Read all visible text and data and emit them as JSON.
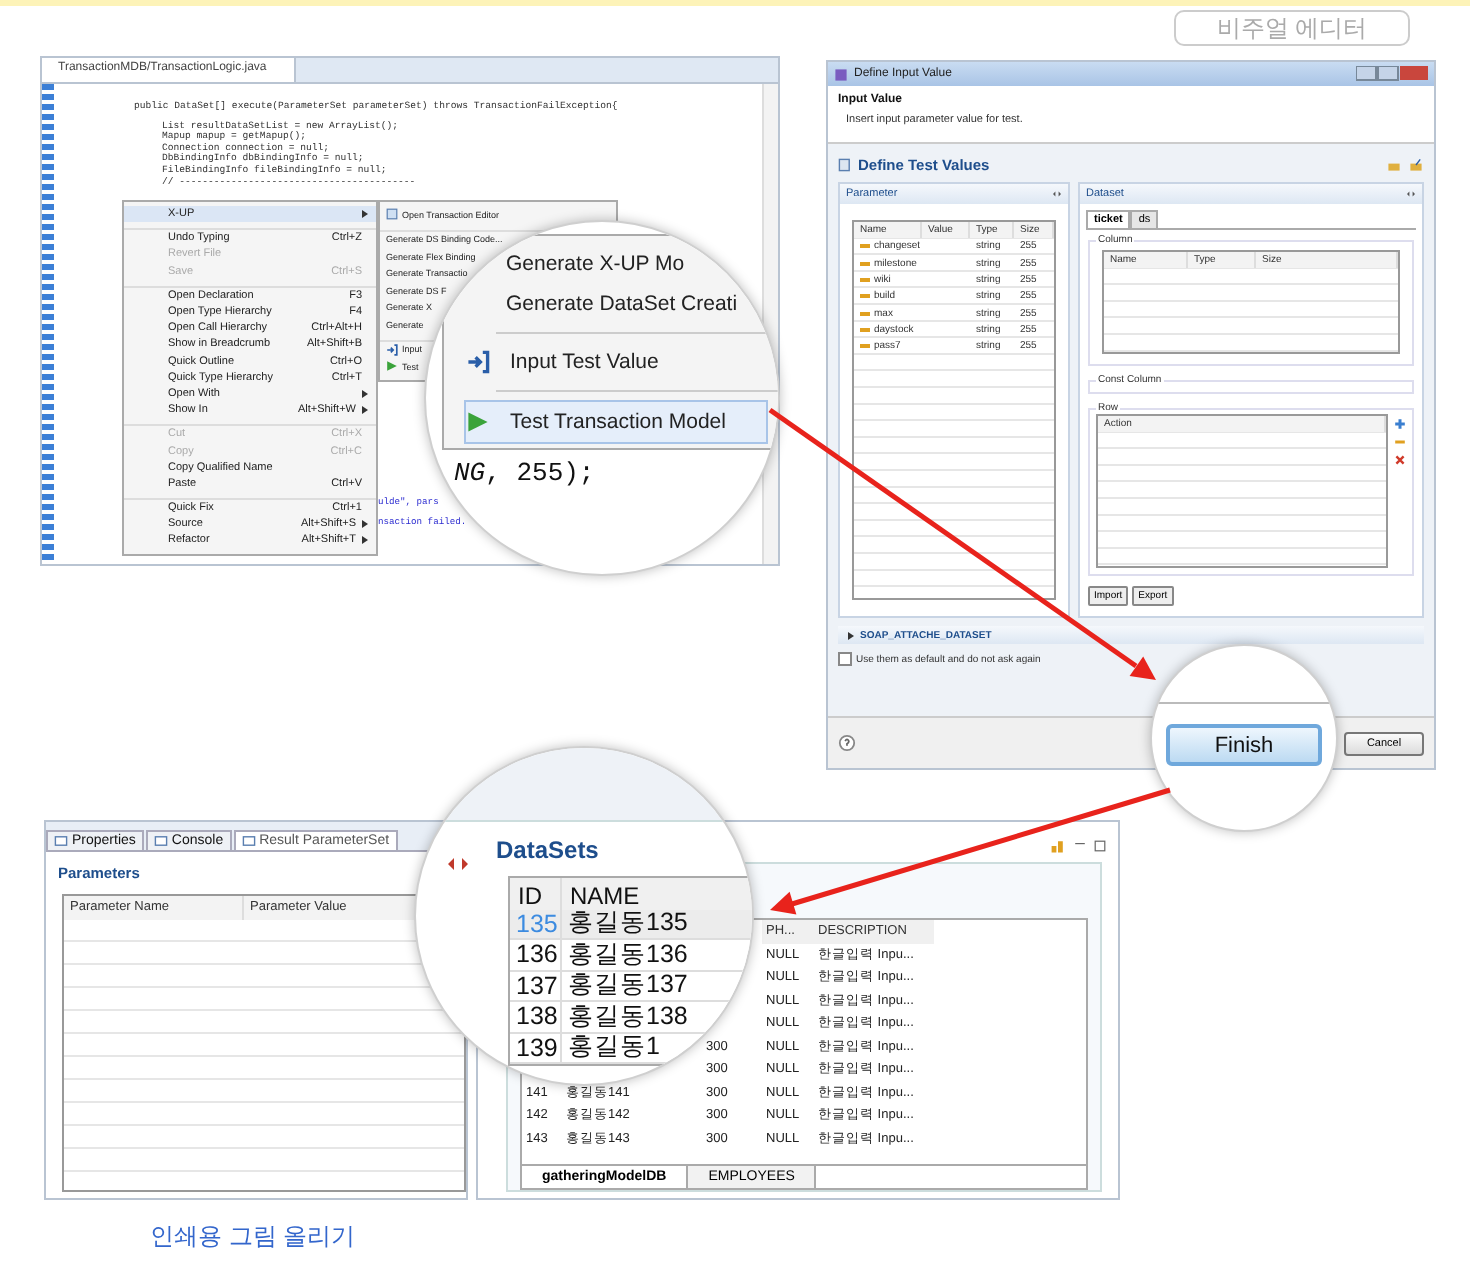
{
  "top_bar": {
    "button": "비주얼 에디터"
  },
  "editor": {
    "tab": "TransactionMDB/TransactionLogic.java",
    "code_lines": [
      "public DataSet[] execute(ParameterSet parameterSet) throws TransactionFailException{",
      "List resultDataSetList = new ArrayList();",
      "Mapup mapup = getMapup();",
      "Connection connection = null;",
      "DbBindingInfo dbBindingInfo = null;",
      "FileBindingInfo fileBindingInfo = null;",
      "// -----------------------------------------"
    ],
    "code_fragments": [
      "ulde\", pars",
      "nsaction failed."
    ],
    "context_menu": [
      {
        "label": "X-UP",
        "submenu": true,
        "disabled": false,
        "separator_before": false,
        "selected": true
      },
      {
        "label": "Undo Typing",
        "shortcut": "Ctrl+Z",
        "submenu": false,
        "disabled": false,
        "separator_before": true,
        "selected": false
      },
      {
        "label": "Revert File",
        "submenu": false,
        "disabled": true,
        "separator_before": false,
        "selected": false
      },
      {
        "label": "Save",
        "shortcut": "Ctrl+S",
        "submenu": false,
        "disabled": true,
        "separator_before": false,
        "selected": false
      },
      {
        "label": "Open Declaration",
        "shortcut": "F3",
        "submenu": false,
        "disabled": false,
        "separator_before": true,
        "selected": false
      },
      {
        "label": "Open Type Hierarchy",
        "shortcut": "F4",
        "submenu": false,
        "disabled": false,
        "separator_before": false,
        "selected": false
      },
      {
        "label": "Open Call Hierarchy",
        "shortcut": "Ctrl+Alt+H",
        "submenu": false,
        "disabled": false,
        "separator_before": false,
        "selected": false
      },
      {
        "label": "Show in Breadcrumb",
        "shortcut": "Alt+Shift+B",
        "submenu": false,
        "disabled": false,
        "separator_before": false,
        "selected": false
      },
      {
        "label": "Quick Outline",
        "shortcut": "Ctrl+O",
        "submenu": false,
        "disabled": false,
        "separator_before": false,
        "selected": false
      },
      {
        "label": "Quick Type Hierarchy",
        "shortcut": "Ctrl+T",
        "submenu": false,
        "disabled": false,
        "separator_before": false,
        "selected": false
      },
      {
        "label": "Open With",
        "submenu": true,
        "disabled": false,
        "separator_before": false,
        "selected": false
      },
      {
        "label": "Show In",
        "shortcut": "Alt+Shift+W",
        "submenu": true,
        "disabled": false,
        "separator_before": false,
        "selected": false
      },
      {
        "label": "Cut",
        "shortcut": "Ctrl+X",
        "submenu": false,
        "disabled": true,
        "separator_before": true,
        "selected": false
      },
      {
        "label": "Copy",
        "shortcut": "Ctrl+C",
        "submenu": false,
        "disabled": true,
        "separator_before": false,
        "selected": false
      },
      {
        "label": "Copy Qualified Name",
        "submenu": false,
        "disabled": false,
        "separator_before": false,
        "selected": false
      },
      {
        "label": "Paste",
        "shortcut": "Ctrl+V",
        "submenu": false,
        "disabled": false,
        "separator_before": false,
        "selected": false
      },
      {
        "label": "Quick Fix",
        "shortcut": "Ctrl+1",
        "submenu": false,
        "disabled": false,
        "separator_before": true,
        "selected": false
      },
      {
        "label": "Source",
        "shortcut": "Alt+Shift+S",
        "submenu": true,
        "disabled": false,
        "separator_before": false,
        "selected": false
      },
      {
        "label": "Refactor",
        "shortcut": "Alt+Shift+T",
        "submenu": true,
        "disabled": false,
        "separator_before": false,
        "selected": false
      }
    ],
    "submenu": [
      {
        "label": "Open Transaction Editor",
        "kind": "editor",
        "separator_before": false
      },
      {
        "label": "Generate DS Binding Code...",
        "kind": "plain",
        "separator_before": true
      },
      {
        "label": "Generate Flex Binding",
        "kind": "plain",
        "separator_before": false
      },
      {
        "label": "Generate Transactio",
        "kind": "plain",
        "separator_before": false
      },
      {
        "label": "Generate DS F",
        "kind": "plain",
        "separator_before": false
      },
      {
        "label": "Generate X",
        "kind": "plain",
        "separator_before": false
      },
      {
        "label": "Generate",
        "kind": "plain",
        "separator_before": false
      },
      {
        "label": "Input",
        "kind": "input",
        "separator_before": true
      },
      {
        "label": "Test",
        "kind": "run",
        "separator_before": false
      }
    ],
    "magnifier": {
      "items": [
        {
          "label": "Generate X-UP Mo",
          "kind": "plain",
          "separator_before": false,
          "selected": false
        },
        {
          "label": "Generate DataSet Creati",
          "kind": "plain",
          "separator_before": false,
          "selected": false
        },
        {
          "label": "Input Test Value",
          "kind": "input",
          "separator_before": true,
          "selected": false
        },
        {
          "label": "Test Transaction Model",
          "kind": "run",
          "separator_before": true,
          "selected": true
        }
      ],
      "code": "*NG*, 255);"
    }
  },
  "dialog": {
    "title": "Define Input Value",
    "header_title": "Input Value",
    "header_text": "Insert input parameter value for test.",
    "section_title": "Define Test Values",
    "parameter": {
      "title": "Parameter",
      "columns": [
        "Name",
        "Value",
        "Type",
        "Size"
      ],
      "rows": [
        {
          "name": "changeset",
          "type": "string",
          "size": "255"
        },
        {
          "name": "milestone",
          "type": "string",
          "size": "255"
        },
        {
          "name": "wiki",
          "type": "string",
          "size": "255"
        },
        {
          "name": "build",
          "type": "string",
          "size": "255"
        },
        {
          "name": "max",
          "type": "string",
          "size": "255"
        },
        {
          "name": "daystock",
          "type": "string",
          "size": "255"
        },
        {
          "name": "pass7",
          "type": "string",
          "size": "255"
        }
      ]
    },
    "dataset": {
      "title": "Dataset",
      "tabs": [
        {
          "label": "ticket",
          "selected": true
        },
        {
          "label": "ds",
          "selected": false
        }
      ],
      "column_group": "Column",
      "column_headers": [
        "Name",
        "Type",
        "Size"
      ],
      "const_group": "Const Column",
      "row_group": "Row",
      "row_headers": [
        "Action"
      ],
      "buttons": [
        "Import",
        "Export"
      ]
    },
    "soap": "SOAP_ATTACHE_DATASET",
    "checkbox": {
      "label": "Use them as default and do not ask again",
      "checked": false
    },
    "finish": "Finish",
    "cancel": "Cancel"
  },
  "result_panel": {
    "tabs": [
      {
        "label": "Properties",
        "selected": false
      },
      {
        "label": "Console",
        "selected": false
      },
      {
        "label": "Result ParameterSet",
        "selected": true
      }
    ],
    "title": "Parameters",
    "columns": [
      "Parameter Name",
      "Parameter Value"
    ]
  },
  "datasets_panel": {
    "columns": [
      "PH...",
      "DESCRIPTION"
    ],
    "rows": [
      {
        "ph": "NULL",
        "description": "한글입력 Inpu..."
      },
      {
        "ph": "NULL",
        "description": "한글입력 Inpu..."
      },
      {
        "ph": "NULL",
        "description": "한글입력 Inpu..."
      },
      {
        "ph": "NULL",
        "description": "한글입력 Inpu..."
      },
      {
        "size": "300",
        "ph": "NULL",
        "description": "한글입력 Inpu..."
      },
      {
        "size": "300",
        "ph": "NULL",
        "description": "한글입력 Inpu..."
      },
      {
        "id": "141",
        "name": "홍길동141",
        "size": "300",
        "ph": "NULL",
        "description": "한글입력 Inpu..."
      },
      {
        "id": "142",
        "name": "홍길동142",
        "size": "300",
        "ph": "NULL",
        "description": "한글입력 Inpu..."
      },
      {
        "id": "143",
        "name": "홍길동143",
        "size": "300",
        "ph": "NULL",
        "description": "한글입력 Inpu..."
      }
    ],
    "tabs": [
      {
        "label": "gatheringModelDB",
        "selected": true
      },
      {
        "label": "EMPLOYEES",
        "selected": false
      }
    ],
    "magnifier": {
      "title": "DataSets",
      "columns": [
        "ID",
        "NAME"
      ],
      "rows": [
        {
          "id": "135",
          "name": "홍길동135",
          "selected": true
        },
        {
          "id": "136",
          "name": "홍길동136",
          "selected": false
        },
        {
          "id": "137",
          "name": "홍길동137",
          "selected": false
        },
        {
          "id": "138",
          "name": "홍길동138",
          "selected": false
        },
        {
          "id": "139",
          "name": "홍길동1",
          "selected": false
        }
      ]
    }
  },
  "print_link": "인쇄용 그림 올리기"
}
